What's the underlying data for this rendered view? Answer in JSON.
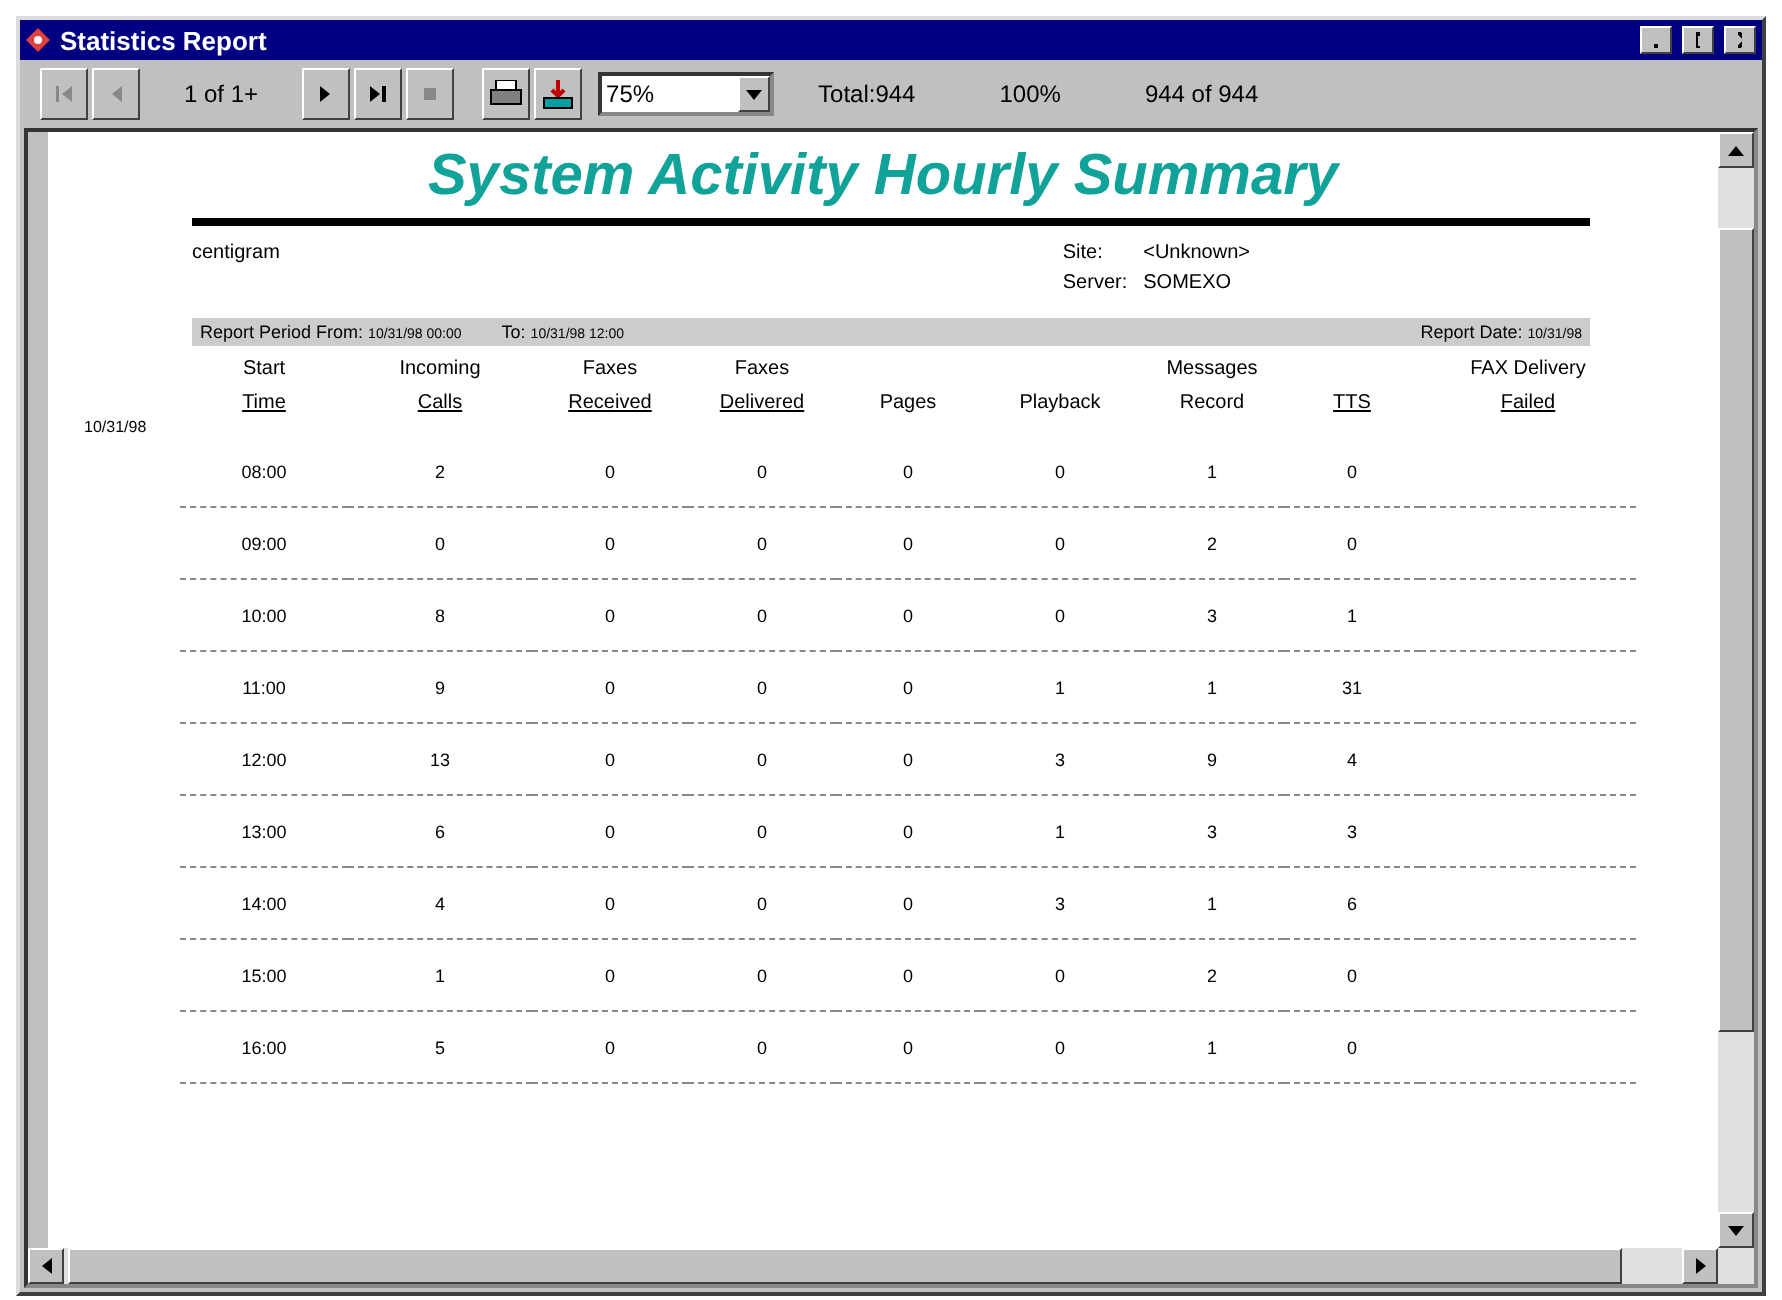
{
  "window": {
    "title": "Statistics Report"
  },
  "toolbar": {
    "page": "1 of 1+",
    "zoom": "75%",
    "total": "Total:944",
    "percent": "100%",
    "count": "944 of 944"
  },
  "report": {
    "title": "System Activity Hourly Summary",
    "company": "centigram",
    "site_label": "Site:",
    "site": "<Unknown>",
    "server_label": "Server:",
    "server": "SOMEXO",
    "period_label": "Report Period From:",
    "period_from": "10/31/98 00:00",
    "to_label": "To:",
    "period_to": "10/31/98 12:00",
    "date_label": "Report Date:",
    "date": "10/31/98",
    "messages_label": "Messages",
    "columns": [
      {
        "top": "Start",
        "bottom": "Time"
      },
      {
        "top": "Incoming",
        "bottom": "Calls"
      },
      {
        "top": "Faxes",
        "bottom": "Received"
      },
      {
        "top": "Faxes",
        "bottom": "Delivered"
      },
      {
        "bottom": "Pages"
      },
      {
        "bottom": "Playback"
      },
      {
        "bottom": "Record"
      },
      {
        "bottom": "TTS"
      },
      {
        "top": "FAX Delivery",
        "bottom": "Failed"
      }
    ],
    "group_date": "10/31/98",
    "rows": [
      [
        "08:00",
        "2",
        "0",
        "0",
        "0",
        "0",
        "1",
        "0"
      ],
      [
        "09:00",
        "0",
        "0",
        "0",
        "0",
        "0",
        "2",
        "0"
      ],
      [
        "10:00",
        "8",
        "0",
        "0",
        "0",
        "0",
        "3",
        "1"
      ],
      [
        "11:00",
        "9",
        "0",
        "0",
        "0",
        "1",
        "1",
        "31"
      ],
      [
        "12:00",
        "13",
        "0",
        "0",
        "0",
        "3",
        "9",
        "4"
      ],
      [
        "13:00",
        "6",
        "0",
        "0",
        "0",
        "1",
        "3",
        "3"
      ],
      [
        "14:00",
        "4",
        "0",
        "0",
        "0",
        "3",
        "1",
        "6"
      ],
      [
        "15:00",
        "1",
        "0",
        "0",
        "0",
        "0",
        "2",
        "0"
      ],
      [
        "16:00",
        "5",
        "0",
        "0",
        "0",
        "0",
        "1",
        "0"
      ]
    ]
  }
}
